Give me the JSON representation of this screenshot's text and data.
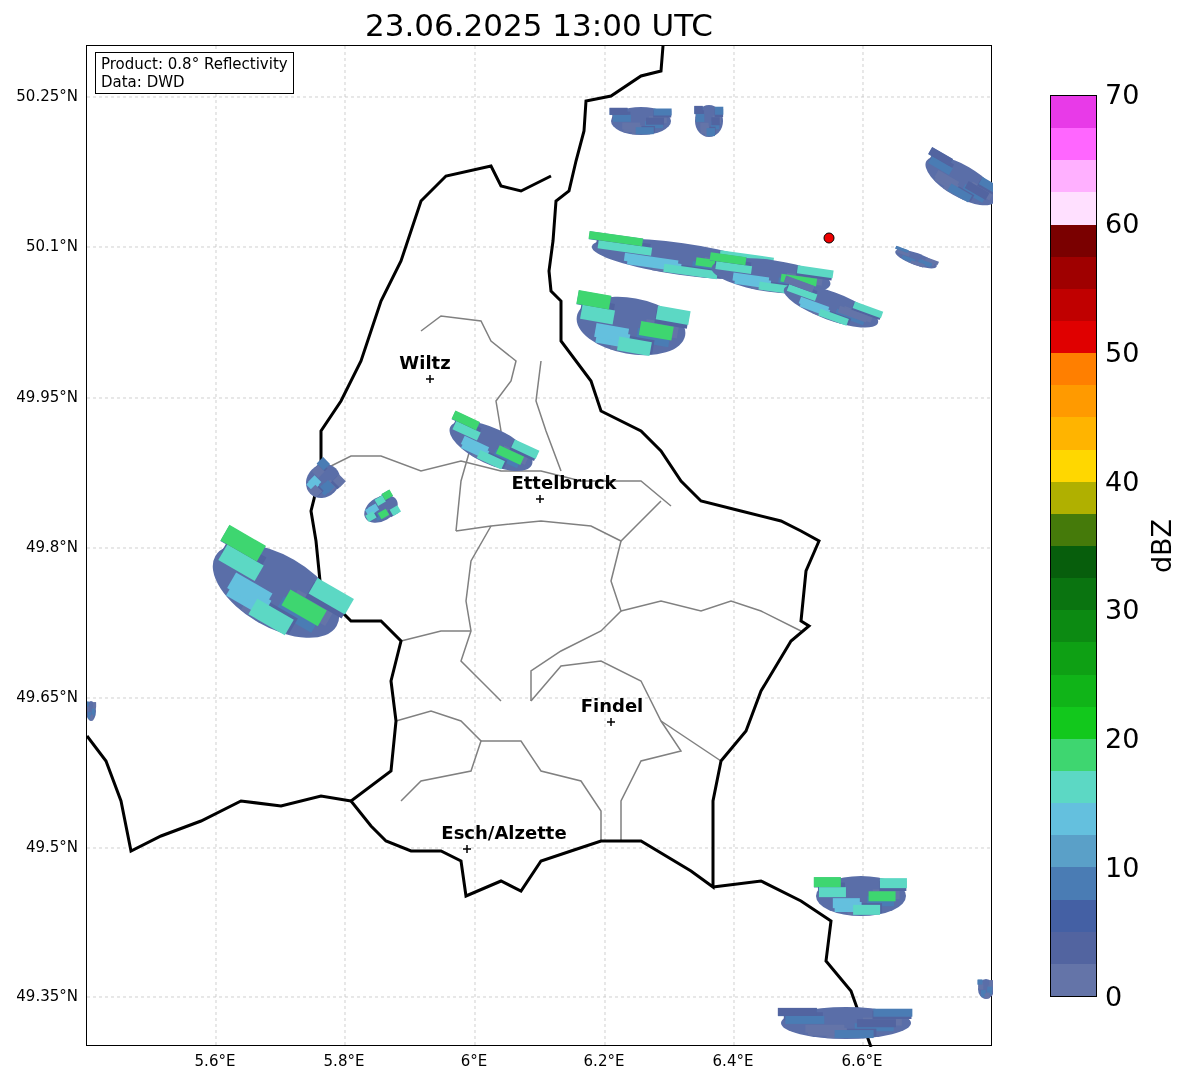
{
  "title": "23.06.2025 13:00 UTC",
  "info_box": {
    "lines": [
      "Product: 0.8° Reflectivity",
      "Data: DWD"
    ]
  },
  "map": {
    "lat_labels": [
      "50.25°N",
      "50.1°N",
      "49.95°N",
      "49.8°N",
      "49.65°N",
      "49.5°N",
      "49.35°N"
    ],
    "lon_labels": [
      "5.6°E",
      "5.8°E",
      "6°E",
      "6.2°E",
      "6.4°E",
      "6.6°E"
    ],
    "places": [
      {
        "name": "Wiltz"
      },
      {
        "name": "Ettelbruck"
      },
      {
        "name": "Findel"
      },
      {
        "name": "Esch/Alzette"
      }
    ]
  },
  "colorbar": {
    "label": "dBZ",
    "ticks": [
      "70",
      "60",
      "50",
      "40",
      "30",
      "20",
      "10",
      "0"
    ],
    "bands": [
      {
        "color": "#6474a8"
      },
      {
        "color": "#5264a0"
      },
      {
        "color": "#4460a4"
      },
      {
        "color": "#4a7cb4"
      },
      {
        "color": "#5aa0c8"
      },
      {
        "color": "#64c0de"
      },
      {
        "color": "#5cd8c4"
      },
      {
        "color": "#3ed670"
      },
      {
        "color": "#12c81c"
      },
      {
        "color": "#10b418"
      },
      {
        "color": "#0ea014"
      },
      {
        "color": "#0c8a12"
      },
      {
        "color": "#0a7410"
      },
      {
        "color": "#075e0c"
      },
      {
        "color": "#457a0a"
      },
      {
        "color": "#b0b000"
      },
      {
        "color": "#ffd700"
      },
      {
        "color": "#ffb400"
      },
      {
        "color": "#ff9a00"
      },
      {
        "color": "#ff7f00"
      },
      {
        "color": "#e00000"
      },
      {
        "color": "#c00000"
      },
      {
        "color": "#9f0000"
      },
      {
        "color": "#7a0000"
      },
      {
        "color": "#ffe0ff"
      },
      {
        "color": "#ffb0ff"
      },
      {
        "color": "#ff66ff"
      },
      {
        "color": "#e83ae8"
      }
    ]
  }
}
